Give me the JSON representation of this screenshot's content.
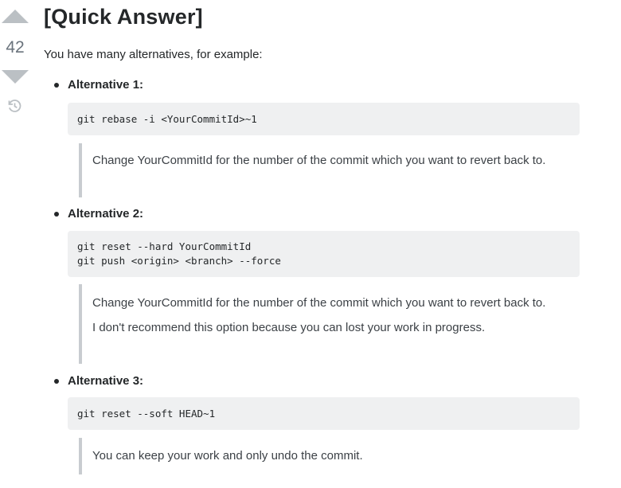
{
  "vote": {
    "count": "42"
  },
  "post": {
    "title": "[Quick Answer]",
    "intro": "You have many alternatives, for example:",
    "alternatives": [
      {
        "label": "Alternative 1:",
        "code": [
          "git rebase -i <YourCommitId>~1"
        ],
        "quote": [
          "Change YourCommitId for the number of the commit which you want to revert back to."
        ]
      },
      {
        "label": "Alternative 2:",
        "code": [
          "git reset --hard YourCommitId",
          "git push <origin> <branch> --force"
        ],
        "quote": [
          "Change YourCommitId for the number of the commit which you want to revert back to.",
          "I don't recommend this option because you can lost your work in progress."
        ]
      },
      {
        "label": "Alternative 3:",
        "code": [
          "git reset --soft HEAD~1"
        ],
        "quote": [
          "You can keep your work and only undo the commit."
        ]
      }
    ]
  },
  "icons": {
    "upvote": "upvote-arrow-icon",
    "downvote": "downvote-arrow-icon",
    "history": "history-icon"
  },
  "colors": {
    "vote_arrow": "#bbc0c4",
    "code_bg": "#eff0f1",
    "quote_bar": "#c8ccd0",
    "text": "#242729"
  }
}
